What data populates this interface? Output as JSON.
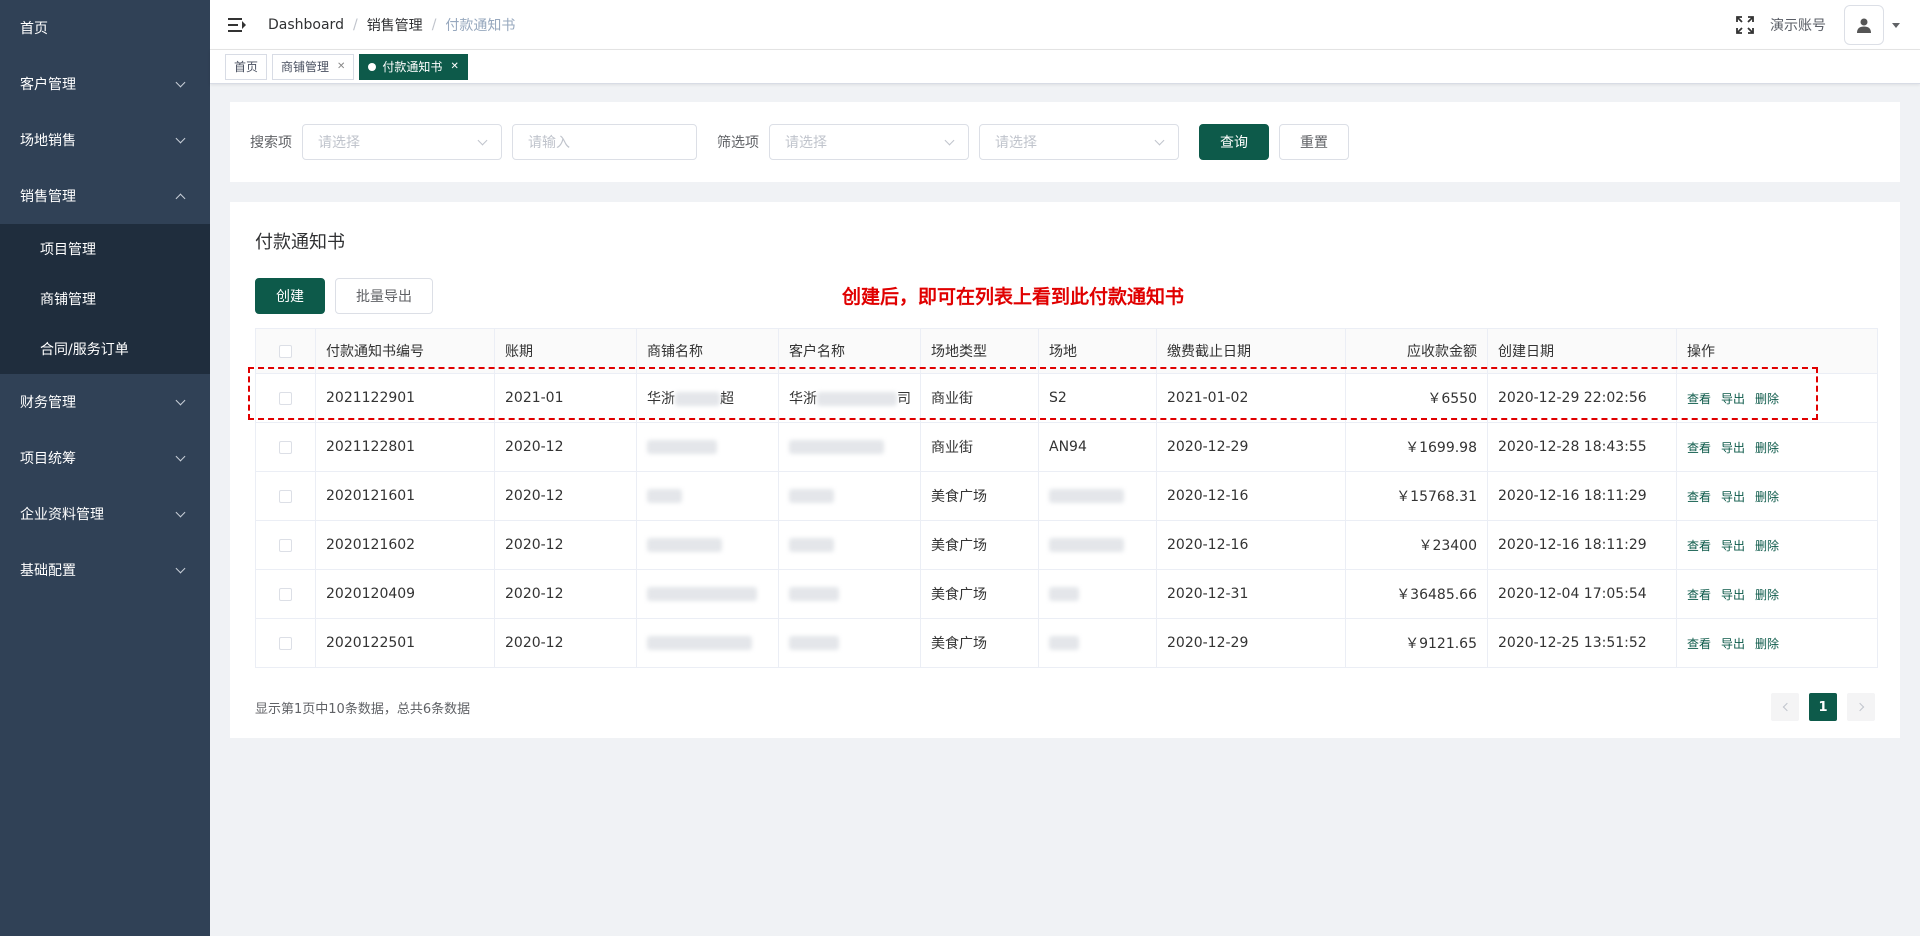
{
  "sidebar": {
    "items": [
      {
        "label": "首页"
      },
      {
        "label": "客户管理"
      },
      {
        "label": "场地销售"
      },
      {
        "label": "销售管理"
      },
      {
        "label": "财务管理"
      },
      {
        "label": "项目统筹"
      },
      {
        "label": "企业资料管理"
      },
      {
        "label": "基础配置"
      }
    ],
    "sub_items": [
      {
        "label": "项目管理"
      },
      {
        "label": "商铺管理"
      },
      {
        "label": "合同/服务订单"
      }
    ]
  },
  "header": {
    "breadcrumb": [
      "Dashboard",
      "销售管理",
      "付款通知书"
    ],
    "account": "演示账号"
  },
  "tags": [
    {
      "label": "首页"
    },
    {
      "label": "商铺管理"
    },
    {
      "label": "付款通知书"
    }
  ],
  "search": {
    "label_search": "搜索项",
    "select_placeholder": "请选择",
    "input_placeholder": "请输入",
    "label_filter": "筛选项",
    "query_button": "查询",
    "reset_button": "重置"
  },
  "list": {
    "title": "付款通知书",
    "create_button": "创建",
    "export_button": "批量导出",
    "annotation": "创建后，即可在列表上看到此付款通知书",
    "columns": [
      "付款通知书编号",
      "账期",
      "商铺名称",
      "客户名称",
      "场地类型",
      "场地",
      "缴费截止日期",
      "应收款金额",
      "创建日期",
      "操作"
    ],
    "rows": [
      {
        "id": "2021122901",
        "period": "2021-01",
        "shop_a": "华浙",
        "shop_b": "超",
        "cust_a": "华浙",
        "cust_b": "司",
        "type": "商业街",
        "site": "S2",
        "deadline": "2021-01-02",
        "amount": "￥6550",
        "created": "2020-12-29 22:02:56"
      },
      {
        "id": "2021122801",
        "period": "2020-12",
        "shop_a": "",
        "shop_b": "",
        "cust_a": "",
        "cust_b": "",
        "type": "商业街",
        "site": "AN94",
        "deadline": "2020-12-29",
        "amount": "￥1699.98",
        "created": "2020-12-28 18:43:55"
      },
      {
        "id": "2020121601",
        "period": "2020-12",
        "shop_a": "",
        "shop_b": "",
        "cust_a": "",
        "cust_b": "",
        "type": "美食广场",
        "site": "",
        "deadline": "2020-12-16",
        "amount": "￥15768.31",
        "created": "2020-12-16 18:11:29"
      },
      {
        "id": "2020121602",
        "period": "2020-12",
        "shop_a": "",
        "shop_b": "",
        "cust_a": "",
        "cust_b": "",
        "type": "美食广场",
        "site": "",
        "deadline": "2020-12-16",
        "amount": "￥23400",
        "created": "2020-12-16 18:11:29"
      },
      {
        "id": "2020120409",
        "period": "2020-12",
        "shop_a": "",
        "shop_b": "",
        "cust_a": "",
        "cust_b": "",
        "type": "美食广场",
        "site": "",
        "deadline": "2020-12-31",
        "amount": "￥36485.66",
        "created": "2020-12-04 17:05:54"
      },
      {
        "id": "2020122501",
        "period": "2020-12",
        "shop_a": "",
        "shop_b": "",
        "cust_a": "",
        "cust_b": "",
        "type": "美食广场",
        "site": "",
        "deadline": "2020-12-29",
        "amount": "￥9121.65",
        "created": "2020-12-25 13:51:52"
      }
    ],
    "ops": {
      "view": "查看",
      "export": "导出",
      "delete": "删除"
    }
  },
  "pager": {
    "summary": "显示第1页中10条数据，总共6条数据",
    "current": "1"
  },
  "colors": {
    "primary": "#0d5a4a",
    "sidebar_bg": "#304156",
    "submenu_bg": "#1f2d3d",
    "annotation": "#e00000"
  }
}
